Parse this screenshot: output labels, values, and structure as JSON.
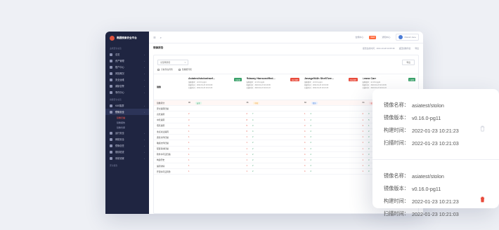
{
  "app": {
    "brand_name": "椭圆镜像安全平台",
    "page_title": "镜像报告"
  },
  "sidebar": {
    "section1": "主机安全总览",
    "items_top": [
      {
        "label": "总览"
      },
      {
        "label": "资产管理"
      },
      {
        "label": "账户中心"
      },
      {
        "label": "风险概况"
      },
      {
        "label": "安全运维"
      },
      {
        "label": "威胁告警"
      },
      {
        "label": "事件中心"
      }
    ],
    "section2": "容器安全总览",
    "items_mid": [
      {
        "label": "K8S集群"
      },
      {
        "label": "镜像安全",
        "active": true
      }
    ],
    "subitems": [
      {
        "label": "镜像扫描",
        "active": true
      },
      {
        "label": "镜像报告"
      },
      {
        "label": "镜像仓库"
      }
    ],
    "items_bottom": [
      {
        "label": "运行安全"
      },
      {
        "label": "网络安全"
      },
      {
        "label": "镜像信任"
      },
      {
        "label": "基线检查"
      },
      {
        "label": "系统设置"
      }
    ],
    "section3": "安全报告"
  },
  "topbar": {
    "search_icon": "search-icon",
    "right_items": [
      "合规中心",
      "通知中心"
    ],
    "badge": "NEW",
    "user_name": "Mariah Jane"
  },
  "page_actions": [
    "报告生成时间：2021-10-28 10:05:36",
    "返回镜像列表",
    "导出"
  ],
  "filters": {
    "select_value": "全部风险项",
    "export_label": "导出",
    "check1": "只看存在风险",
    "check2": "隐藏相同项"
  },
  "grid": {
    "label_head": "镜像",
    "images": [
      {
        "name": "Asiatest/stolonhaef...",
        "tag": "已修复",
        "tag_color": "#3aa16a",
        "meta": [
          "镜像版本：v0.16.0-pg11",
          "构建时间：2022-01-23 10:19:09",
          "扫描时间：2022-01-23 10:21:23"
        ]
      },
      {
        "name": "Rdaany Hansondffed...",
        "tag": "存在风险",
        "tag_color": "#e84a3a",
        "meta": [
          "镜像版本：v0.16.0-pg11",
          "构建时间：2022-01-23 10:19:09",
          "扫描时间：2022-01-23 10:21:23"
        ]
      },
      {
        "name": "Javage544h She57we...",
        "tag": "存在风险",
        "tag_color": "#e84a3a",
        "meta": [
          "镜像版本：v0.16.0-pg11",
          "构建时间：2022-01-23 10:19:09",
          "扫描时间：2022-01-23 10:21:23"
        ]
      },
      {
        "name": "Leava Carr",
        "tag": "已修复",
        "tag_color": "#3aa16a",
        "meta": [
          "镜像版本：v0.16.0-pg11",
          "构建时间：2022-01-23 10:19:09",
          "扫描时间：2022-01-23 10:21:23"
        ]
      }
    ],
    "rows": [
      {
        "label": "镜像评分",
        "risk": true,
        "cells": [
          [
            "96",
            "安全"
          ],
          [
            "36",
            "中危"
          ],
          [
            "60",
            "低危"
          ],
          [
            "64",
            "高危"
          ]
        ]
      },
      {
        "label": "安全漏洞扫描",
        "cells": [
          [],
          [],
          [],
          []
        ]
      },
      {
        "label": "高危漏洞",
        "cells": [
          [
            "2"
          ],
          [
            "2",
            "7"
          ],
          [
            "1",
            "4"
          ],
          [
            "2",
            "3"
          ]
        ]
      },
      {
        "label": "中危漏洞",
        "cells": [
          [
            "3"
          ],
          [
            "8",
            "4"
          ],
          [
            "1",
            "2"
          ],
          [
            "1",
            "5"
          ]
        ]
      },
      {
        "label": "低危漏洞",
        "cells": [
          [
            "4"
          ],
          [
            "5",
            "3"
          ],
          [
            "3",
            "2"
          ],
          [
            "3",
            "1"
          ]
        ]
      },
      {
        "label": "重点关注漏洞",
        "cells": [
          [
            "1"
          ],
          [
            "6",
            "4"
          ],
          [
            "4",
            "2"
          ],
          [
            "1",
            "2"
          ]
        ]
      },
      {
        "label": "恶意文件扫描",
        "cells": [
          [
            "1"
          ],
          [
            "1",
            "2"
          ],
          [
            "4",
            "2"
          ],
          [
            "1",
            "3"
          ]
        ]
      },
      {
        "label": "敏感文件扫描",
        "cells": [
          [
            "1"
          ],
          [
            "1",
            "2"
          ],
          [
            "4",
            "2"
          ],
          [
            "1",
            "3"
          ]
        ]
      },
      {
        "label": "配置基线扫描",
        "cells": [
          [
            "1"
          ],
          [
            "1",
            "2"
          ],
          [
            "4",
            "2"
          ],
          [
            "1",
            "3"
          ]
        ]
      },
      {
        "label": "软件许可证扫描",
        "cells": [
          [
            "1"
          ],
          [
            "1",
            "2"
          ],
          [
            "4",
            "2"
          ],
          [
            "1",
            "3"
          ]
        ]
      },
      {
        "label": "构建历史",
        "cells": [
          [
            "1"
          ],
          [
            "1",
            "2"
          ],
          [
            "4",
            "2"
          ],
          [
            "1",
            "3"
          ]
        ]
      },
      {
        "label": "漏洞详情",
        "cells": [
          [
            "1"
          ],
          [
            "1",
            "2"
          ],
          [
            "4",
            "2"
          ],
          [
            "1",
            "3"
          ]
        ]
      },
      {
        "label": "开源许可证风险",
        "cells": [
          [
            "1"
          ],
          [
            "1",
            "2"
          ],
          [
            "4",
            "2"
          ],
          [
            "1",
            "3"
          ]
        ]
      }
    ]
  },
  "card": {
    "entries": [
      {
        "name_key": "镜像名称：",
        "name": "asiatest/stolon",
        "ver_key": "镜像版本：",
        "ver": "v0.16.0-pg11",
        "build_key": "构建时间：",
        "build": "2022-01-23 10:21:23",
        "scan_key": "扫描时间：",
        "scan": "2022-01-23 10:21:03",
        "trash_color": "#c8ccd6"
      },
      {
        "name_key": "镜像名称：",
        "name": "asiatest/stolon",
        "ver_key": "镜像版本：",
        "ver": "v0.16.0-pg11",
        "build_key": "构建时间：",
        "build": "2022-01-23 10:21:23",
        "scan_key": "扫描时间：",
        "scan": "2022-01-23 10:21:03",
        "trash_color": "#e84a3a"
      }
    ]
  }
}
